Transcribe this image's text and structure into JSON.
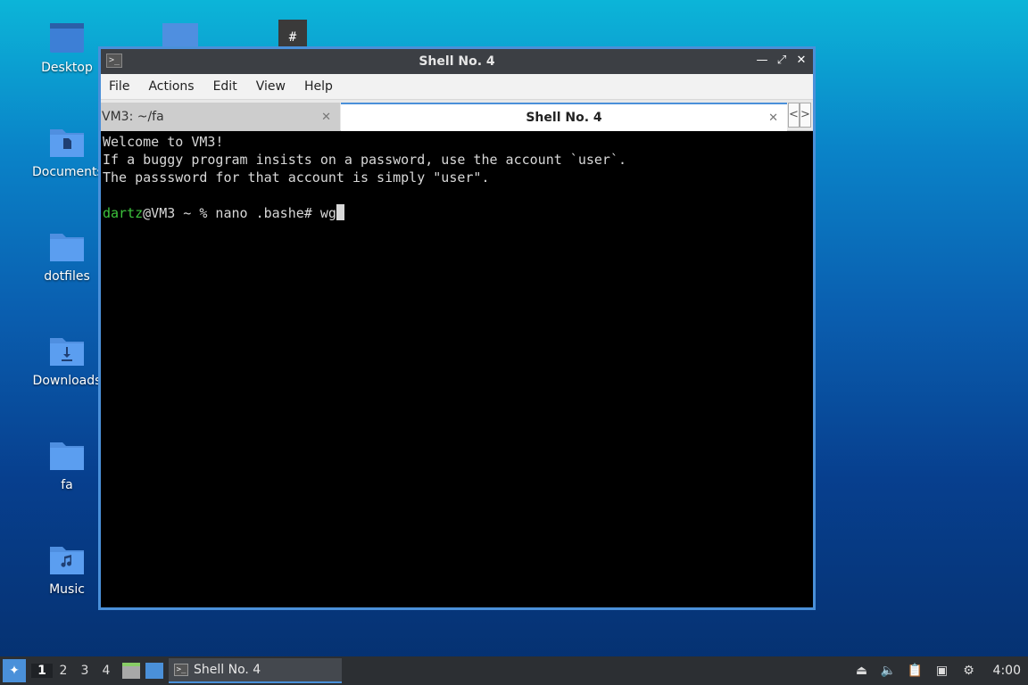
{
  "desktop": {
    "icons": [
      {
        "label": "Desktop",
        "icon": "desktop-folder-icon"
      },
      {
        "label": "Documents",
        "icon": "documents-folder-icon"
      },
      {
        "label": "dotfiles",
        "icon": "folder-icon"
      },
      {
        "label": "Downloads",
        "icon": "downloads-folder-icon"
      },
      {
        "label": "fa",
        "icon": "folder-icon"
      },
      {
        "label": "Music",
        "icon": "music-folder-icon"
      }
    ]
  },
  "window": {
    "title": "Shell No. 4",
    "menu": [
      "File",
      "Actions",
      "Edit",
      "View",
      "Help"
    ],
    "tabs": [
      {
        "label": "VM3: ~/fa",
        "active": false
      },
      {
        "label": "Shell No. 4",
        "active": true
      }
    ],
    "terminal": {
      "lines": [
        "Welcome to VM3!",
        "If a buggy program insists on a password, use the account `user`.",
        "The passsword for that account is simply \"user\"."
      ],
      "prompt_user": "dartz",
      "prompt_rest": "@VM3 ~ % nano .bashe# wg"
    }
  },
  "taskbar": {
    "workspaces": [
      "1",
      "2",
      "3",
      "4"
    ],
    "task_label": "Shell No. 4",
    "clock": "4:00"
  },
  "colors": {
    "accent": "#4a90d9",
    "prompt_user": "#3cc33c",
    "terminal_bg": "#000000",
    "taskbar_bg": "#2c2f33"
  }
}
